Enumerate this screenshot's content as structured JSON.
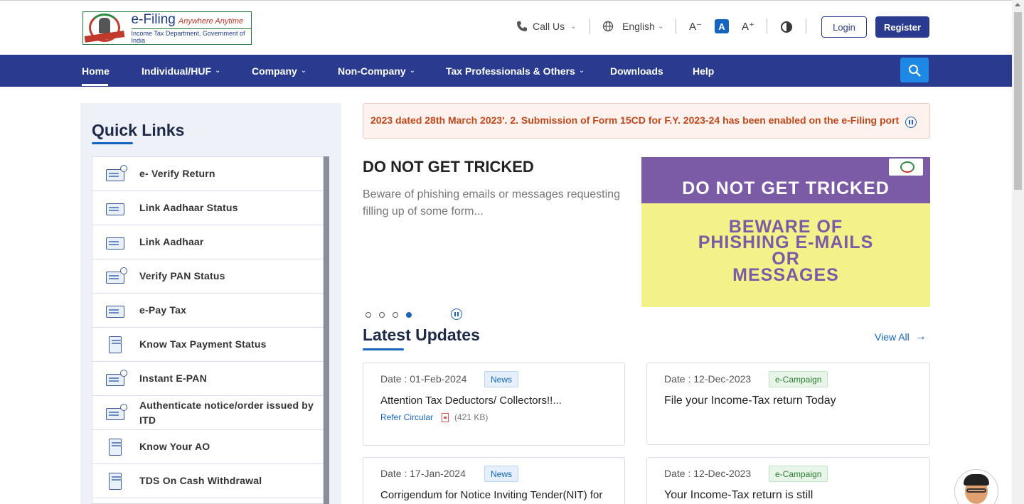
{
  "header": {
    "logo": {
      "title": "e-Filing",
      "tagline": "Anywhere Anytime",
      "subtitle": "Income Tax Department, Government of India"
    },
    "call_us": "Call Us",
    "language": "English",
    "font_decrease": "A⁻",
    "font_normal": "A",
    "font_increase": "A⁺",
    "login": "Login",
    "register": "Register"
  },
  "nav": {
    "items": [
      {
        "label": "Home",
        "has_dropdown": false
      },
      {
        "label": "Individual/HUF",
        "has_dropdown": true
      },
      {
        "label": "Company",
        "has_dropdown": true
      },
      {
        "label": "Non-Company",
        "has_dropdown": true
      },
      {
        "label": "Tax Professionals & Others",
        "has_dropdown": true
      },
      {
        "label": "Downloads",
        "has_dropdown": false
      },
      {
        "label": "Help",
        "has_dropdown": false
      }
    ]
  },
  "quick_links": {
    "title": "Quick Links",
    "items": [
      "e- Verify Return",
      "Link Aadhaar Status",
      "Link Aadhaar",
      "Verify PAN Status",
      "e-Pay Tax",
      "Know Tax Payment Status",
      "Instant E-PAN",
      "Authenticate notice/order issued by ITD",
      "Know Your AO",
      "TDS On Cash Withdrawal"
    ]
  },
  "ticker": {
    "text": "2023 dated 28th March 2023'. 2. Submission of Form 15CD for F.Y. 2023-24 has been enabled on the e-Filing port"
  },
  "banner": {
    "title": "DO NOT GET TRICKED",
    "description": "Beware of phishing emails or messages requesting filling up of some form...",
    "image_heading": "DO NOT GET TRICKED",
    "image_lines": [
      "BEWARE OF",
      "PHISHING E-MAILS",
      "OR",
      "MESSAGES"
    ],
    "slide_count": 4,
    "active_slide": 4
  },
  "latest_updates": {
    "title": "Latest Updates",
    "view_all": "View All",
    "cards": [
      {
        "date": "Date : 01-Feb-2024",
        "badge": "News",
        "headline": "Attention Tax Deductors/ Collectors!!...",
        "link": "Refer Circular",
        "size": "(421 KB)"
      },
      {
        "date": "Date : 12-Dec-2023",
        "badge": "e-Campaign",
        "headline": "File your Income-Tax return Today"
      },
      {
        "date": "Date : 17-Jan-2024",
        "badge": "News",
        "headline": "Corrigendum for Notice Inviting Tender(NIT) for"
      },
      {
        "date": "Date : 12-Dec-2023",
        "badge": "e-Campaign",
        "headline": "Your Income-Tax return is still"
      }
    ]
  },
  "colors": {
    "nav_bg": "#2a3b8f",
    "accent": "#1565c0",
    "ticker_text": "#c0471a",
    "banner_purple": "#7b5aa6",
    "banner_yellow": "#f3f18a"
  }
}
